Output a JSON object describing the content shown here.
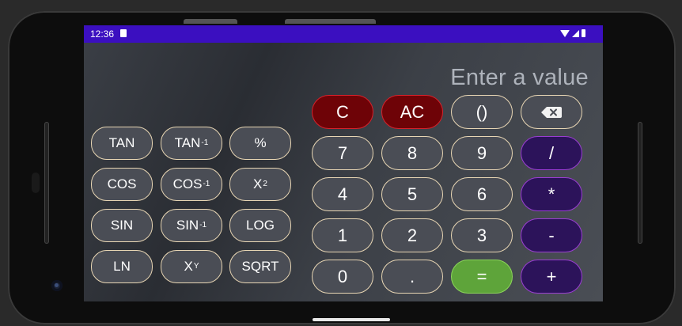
{
  "status_bar": {
    "time": "12:36"
  },
  "display": {
    "placeholder": "Enter a value"
  },
  "scientific": [
    [
      {
        "label": "TAN",
        "sup": ""
      },
      {
        "label": "TAN",
        "sup": "-1"
      },
      {
        "label": "%",
        "sup": ""
      }
    ],
    [
      {
        "label": "COS",
        "sup": ""
      },
      {
        "label": "COS",
        "sup": "-1"
      },
      {
        "label": "X",
        "sup": "2"
      }
    ],
    [
      {
        "label": "SIN",
        "sup": ""
      },
      {
        "label": "SIN",
        "sup": "-1"
      },
      {
        "label": "LOG",
        "sup": ""
      }
    ],
    [
      {
        "label": "LN",
        "sup": ""
      },
      {
        "label": "X",
        "sup": "Y"
      },
      {
        "label": "SQRT",
        "sup": ""
      }
    ]
  ],
  "keypad": {
    "clear": "C",
    "all_clear": "AC",
    "parens": "()",
    "backspace_icon": "backspace-icon",
    "rows": [
      [
        "7",
        "8",
        "9",
        "/"
      ],
      [
        "4",
        "5",
        "6",
        "*"
      ],
      [
        "1",
        "2",
        "3",
        "-"
      ],
      [
        "0",
        ".",
        "=",
        "+"
      ]
    ]
  },
  "colors": {
    "status_bar": "#3b0fc0",
    "clear_fill": "#6e0307",
    "operator_fill": "#2c135a",
    "equals_fill": "#5ea43a",
    "button_border": "#e8d6b4"
  }
}
